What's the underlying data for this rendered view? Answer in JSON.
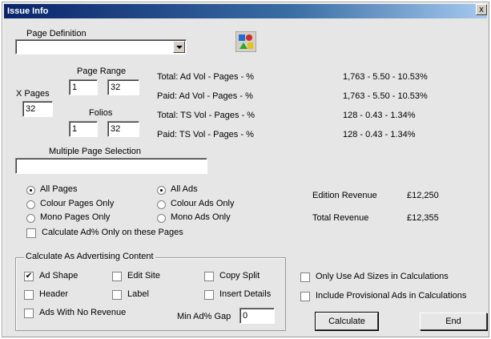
{
  "window": {
    "title": "Issue Info",
    "close_label": "x"
  },
  "page_definition": {
    "label": "Page Definition",
    "value": ""
  },
  "page_range": {
    "label": "Page Range",
    "x_pages_label": "X Pages",
    "x_pages_value": "32",
    "from": "1",
    "to": "32"
  },
  "folios": {
    "label": "Folios",
    "from": "1",
    "to": "32"
  },
  "multiple_page_selection": {
    "label": "Multiple Page Selection",
    "value": ""
  },
  "stats": [
    {
      "label": "Total: Ad Vol - Pages - %",
      "value": "1,763 - 5.50 - 10.53%"
    },
    {
      "label": "Paid: Ad Vol - Pages - %",
      "value": "1,763 - 5.50 - 10.53%"
    },
    {
      "label": "Total: TS Vol - Pages - %",
      "value": "128 - 0.43 - 1.34%"
    },
    {
      "label": "Paid: TS Vol - Pages - %",
      "value": "128 - 0.43 - 1.34%"
    }
  ],
  "pages_radios": [
    {
      "label": "All Pages",
      "checked": true
    },
    {
      "label": "Colour Pages Only",
      "checked": false
    },
    {
      "label": "Mono Pages Only",
      "checked": false
    }
  ],
  "ads_radios": [
    {
      "label": "All Ads",
      "checked": true
    },
    {
      "label": "Colour Ads Only",
      "checked": false
    },
    {
      "label": "Mono Ads Only",
      "checked": false
    }
  ],
  "calc_on_pages": {
    "label": "Calculate Ad% Only on these Pages",
    "checked": false
  },
  "revenue": {
    "edition_label": "Edition Revenue",
    "edition_value": "£12,250",
    "total_label": "Total Revenue",
    "total_value": "£12,355"
  },
  "advertising_content": {
    "title": "Calculate As Advertising Content",
    "ad_shape": {
      "label": "Ad Shape",
      "checked": true
    },
    "edit_site": {
      "label": "Edit Site",
      "checked": false
    },
    "copy_split": {
      "label": "Copy Split",
      "checked": false
    },
    "header": {
      "label": "Header",
      "checked": false
    },
    "label_opt": {
      "label": "Label",
      "checked": false
    },
    "insert_details": {
      "label": "Insert Details",
      "checked": false
    },
    "no_revenue": {
      "label": "Ads With No Revenue",
      "checked": false
    },
    "min_gap_label": "Min Ad% Gap",
    "min_gap_value": "0"
  },
  "options": {
    "ad_sizes": {
      "label": "Only Use Ad Sizes in Calculations",
      "checked": false
    },
    "provisional": {
      "label": "Include Provisional Ads in Calculations",
      "checked": false
    }
  },
  "buttons": {
    "calculate": "Calculate",
    "end": "End"
  },
  "icons": {
    "app": "shapes-icon"
  },
  "check_mark": "✔"
}
